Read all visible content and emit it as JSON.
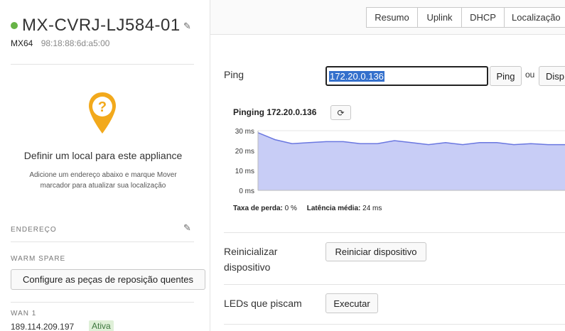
{
  "device": {
    "name": "MX-CVRJ-LJ584-01",
    "model": "MX64",
    "mac": "98:18:88:6d:a5:00",
    "status_color": "#67b346"
  },
  "location": {
    "title": "Definir um local para este appliance",
    "description": "Adicione um endereço abaixo e marque Mover marcador para atualizar sua localização",
    "pin_glyph": "?"
  },
  "address": {
    "label": "ENDEREÇO"
  },
  "warm_spare": {
    "label": "WARM SPARE",
    "button_label": "Configure as peças de reposição quentes"
  },
  "wan1": {
    "label": "WAN 1",
    "ip": "189.114.209.197",
    "status": "Ativa"
  },
  "tabs": [
    "Resumo",
    "Uplink",
    "DHCP",
    "Localização"
  ],
  "ping": {
    "label": "Ping",
    "input_value": "172.20.0.136",
    "button_label": "Ping",
    "or_text": "ou",
    "alt_button_label": "Disp"
  },
  "chart_header": {
    "title": "Pinging 172.20.0.136",
    "refresh_icon": "⟳"
  },
  "chart_data": {
    "type": "area",
    "title": "Pinging 172.20.0.136",
    "xlabel": "",
    "ylabel": "",
    "ylim": [
      0,
      30
    ],
    "yticks": [
      "30 ms",
      "20 ms",
      "10 ms",
      "0 ms"
    ],
    "grid": true,
    "series": [
      {
        "values": [
          29,
          25.5,
          23.5,
          24,
          24.5,
          24.5,
          23.5,
          23.5,
          25,
          24,
          23,
          24,
          23,
          24,
          24,
          23,
          23.5,
          23,
          23
        ]
      }
    ],
    "fill_color": "#c8cdf6",
    "line_color": "#6a77e0"
  },
  "stats": {
    "loss_label": "Taxa de perda:",
    "loss_value": "0 %",
    "latency_label": "Latência média:",
    "latency_value": "24 ms"
  },
  "reboot": {
    "label_line1": "Reinicializar",
    "label_line2": "dispositivo",
    "button_label": "Reiniciar dispositivo"
  },
  "blink": {
    "label": "LEDs que piscam",
    "button_label": "Executar"
  }
}
